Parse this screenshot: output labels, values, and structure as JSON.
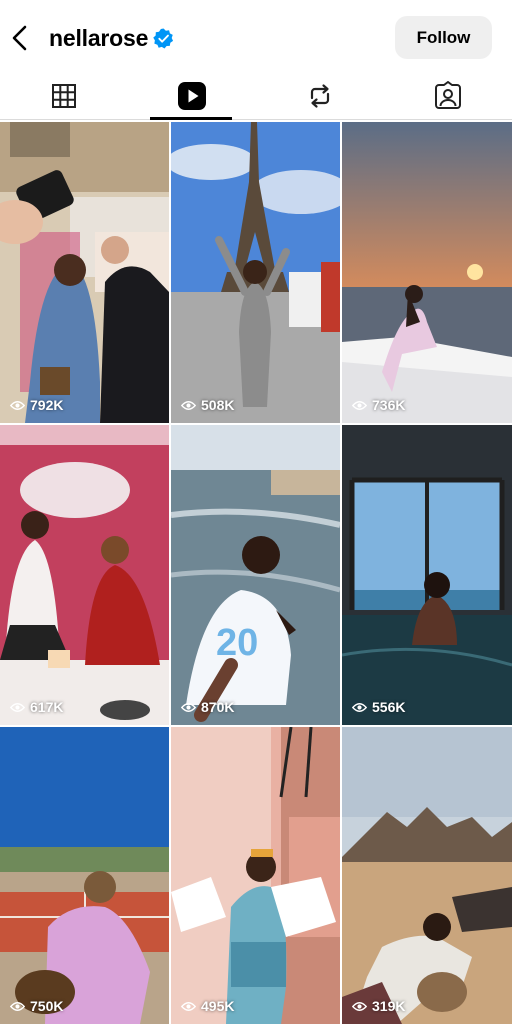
{
  "header": {
    "username": "nellarose",
    "verified": true,
    "follow_label": "Follow"
  },
  "tabs": [
    {
      "name": "posts",
      "icon": "grid-icon",
      "active": false
    },
    {
      "name": "reels",
      "icon": "reels-play-icon",
      "active": true
    },
    {
      "name": "reposts",
      "icon": "repost-icon",
      "active": false
    },
    {
      "name": "tagged",
      "icon": "tagged-person-icon",
      "active": false
    }
  ],
  "reels": [
    {
      "views": "792K"
    },
    {
      "views": "508K"
    },
    {
      "views": "736K"
    },
    {
      "views": "617K"
    },
    {
      "views": "870K"
    },
    {
      "views": "556K"
    },
    {
      "views": "750K"
    },
    {
      "views": "495K"
    },
    {
      "views": "319K"
    }
  ],
  "colors": {
    "verified_blue": "#0095f6",
    "follow_bg": "#efefef",
    "text": "#000000"
  }
}
